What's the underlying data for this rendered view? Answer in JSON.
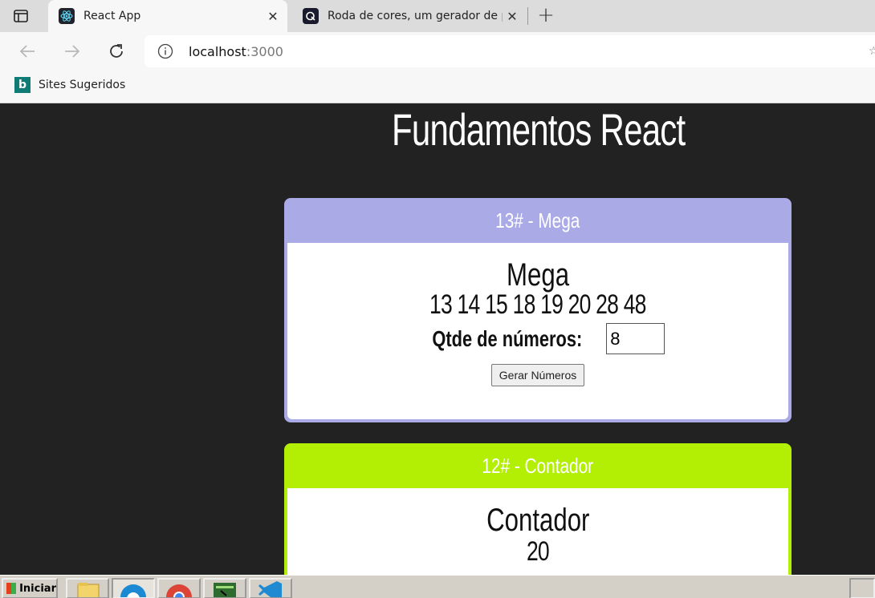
{
  "browser": {
    "tabs": [
      {
        "title": "React App",
        "icon": "react-icon",
        "active": true
      },
      {
        "title": "Roda de cores, um gerador de paletas",
        "icon": "colorwheel-icon",
        "active": false
      }
    ],
    "close_glyph": "✕",
    "new_tab_glyph": "+",
    "url_host": "localhost",
    "url_port": ":3000",
    "bookmarks": [
      {
        "label": "Sites Sugeridos",
        "icon": "bing-icon"
      }
    ]
  },
  "page": {
    "title": "Fundamentos React",
    "cards": [
      {
        "header": "13# - Mega",
        "heading": "Mega",
        "numbers": "13 14 15 18 19 20 28 48",
        "qtd_label": "Qtde de números:",
        "qtd_value": "8",
        "button_label": "Gerar Números",
        "color": "#aaaae6"
      },
      {
        "header": "12# - Contador",
        "heading": "Contador",
        "value": "20",
        "color": "#b2ef04"
      }
    ]
  },
  "taskbar": {
    "start_label": "Iniciar",
    "apps": [
      "explorer-icon",
      "edge-icon",
      "chrome-icon",
      "terminal-icon",
      "vscode-icon"
    ]
  }
}
